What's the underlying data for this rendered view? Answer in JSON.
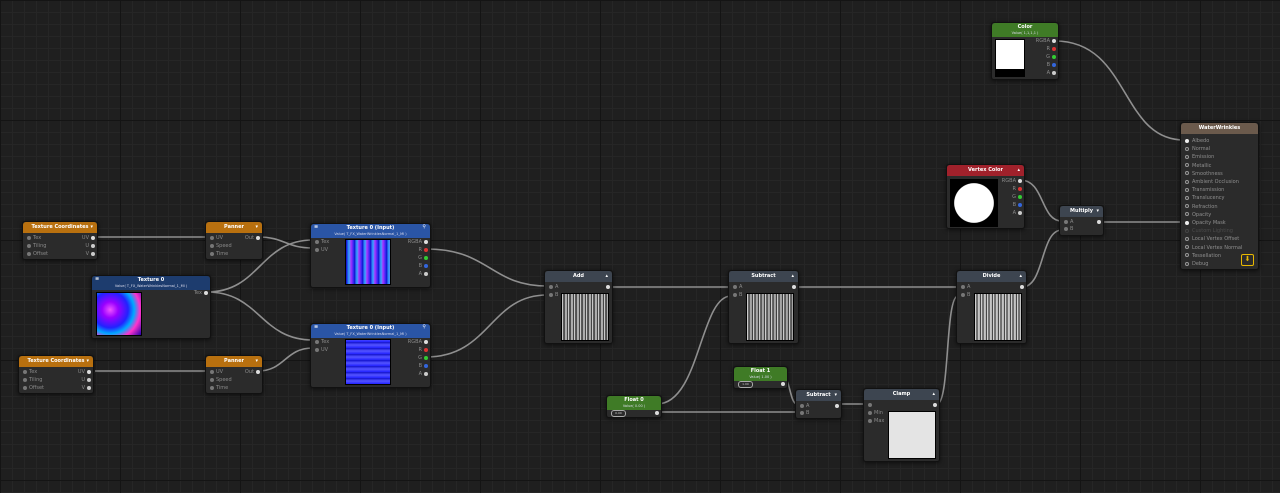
{
  "nodes": {
    "texcoord1": {
      "title": "Texture Coordinates",
      "inputs": [
        "Tex",
        "Tiling",
        "Offset"
      ],
      "outputs": [
        "UV",
        "U",
        "V"
      ]
    },
    "texcoord2": {
      "title": "Texture Coordinates",
      "inputs": [
        "Tex",
        "Tiling",
        "Offset"
      ],
      "outputs": [
        "UV",
        "U",
        "V"
      ]
    },
    "panner1": {
      "title": "Panner",
      "inputs": [
        "UV",
        "Speed",
        "Time"
      ],
      "output": "Out"
    },
    "panner2": {
      "title": "Panner",
      "inputs": [
        "UV",
        "Speed",
        "Time"
      ],
      "output": "Out"
    },
    "tex0": {
      "title": "Texture 0",
      "subtitle": "Value( T_FX_WaterWrinklesNormal_1_MI )",
      "output": "Tex"
    },
    "texinput1": {
      "title": "Texture 0 (Input)",
      "subtitle": "Value( T_FX_WaterWrinklesNormal_1_MI )",
      "inputs": [
        "Tex",
        "UV"
      ],
      "outputs": [
        "RGBA",
        "R",
        "G",
        "B",
        "A"
      ]
    },
    "texinput2": {
      "title": "Texture 0 (Input)",
      "subtitle": "Value( T_FX_WaterWrinklesNormal_1_MI )",
      "inputs": [
        "Tex",
        "UV"
      ],
      "outputs": [
        "RGBA",
        "R",
        "G",
        "B",
        "A"
      ]
    },
    "add": {
      "title": "Add",
      "inputs": [
        "A",
        "B"
      ]
    },
    "subtract1": {
      "title": "Subtract",
      "inputs": [
        "A",
        "B"
      ]
    },
    "divide": {
      "title": "Divide",
      "inputs": [
        "A",
        "B"
      ]
    },
    "float0": {
      "title": "Float 0",
      "subtitle": "Value( 0.00 )",
      "value": "0.00"
    },
    "float1": {
      "title": "Float 1",
      "subtitle": "Value( 1.00 )",
      "value": "1.00"
    },
    "subtract2": {
      "title": "Subtract",
      "inputs": [
        "A",
        "B"
      ]
    },
    "clamp": {
      "title": "Clamp",
      "inputs": [
        "",
        "Min",
        "Max"
      ]
    },
    "color": {
      "title": "Color",
      "subtitle": "Value( 1,1,1,1 )",
      "outputs": [
        "RGBA",
        "R",
        "G",
        "B",
        "A"
      ]
    },
    "vertexcolor": {
      "title": "Vertex Color",
      "outputs": [
        "RGBA",
        "R",
        "G",
        "B",
        "A"
      ]
    },
    "multiply": {
      "title": "Multiply",
      "inputs": [
        "A",
        "B"
      ]
    },
    "output": {
      "title": "WaterWrinkles",
      "properties": [
        "Albedo",
        "Normal",
        "Emission",
        "Metallic",
        "Smoothness",
        "Ambient Occlusion",
        "Transmission",
        "Translucency",
        "Refraction",
        "Opacity",
        "Opacity Mask",
        "Custom Lighting",
        "Local Vertex Offset",
        "Local Vertex Normal",
        "Tessellation",
        "Debug"
      ]
    }
  },
  "colors": {
    "wire": "#9a9a9a",
    "texcoord": "#b8700f",
    "texture": "#2a55a6",
    "operator": "#3d4550",
    "float": "#3f7b26",
    "vertex": "#a0212b",
    "output": "#6b5a4c"
  }
}
